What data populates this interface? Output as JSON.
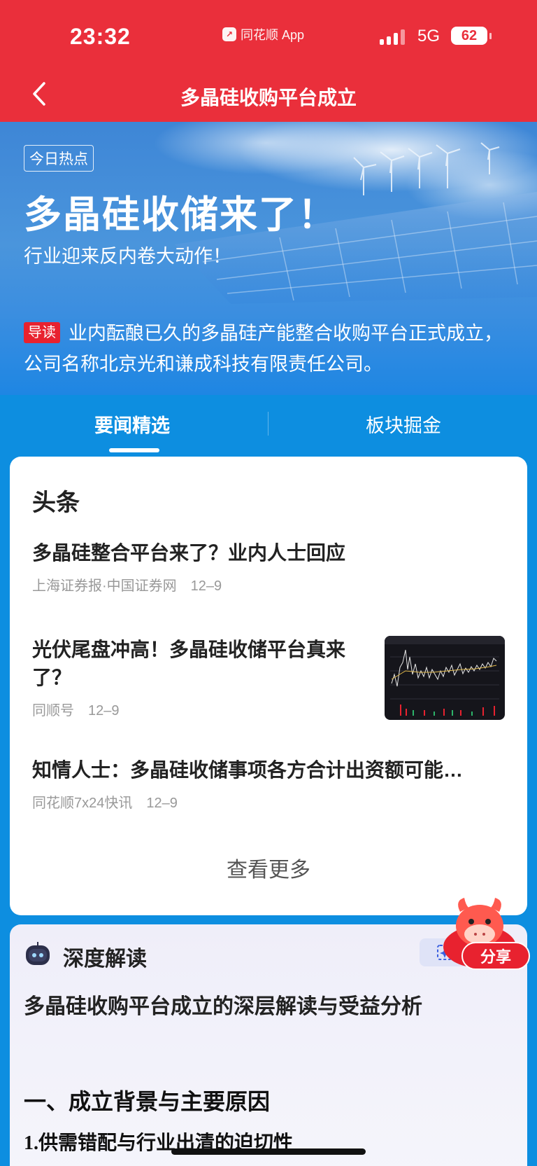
{
  "status_bar": {
    "time": "23:32",
    "app_name": "同花顺 App",
    "network": "5G",
    "battery": "62"
  },
  "nav": {
    "title": "多晶硅收购平台成立"
  },
  "hero": {
    "tag": "今日热点",
    "title": "多晶硅收储来了！",
    "subtitle": "行业迎来反内卷大动作！",
    "guide_tag": "导读",
    "guide_text": "业内酝酿已久的多晶硅产能整合收购平台正式成立，公司名称北京光和谦成科技有限责任公司。"
  },
  "tabs": [
    {
      "label": "要闻精选",
      "active": true
    },
    {
      "label": "板块掘金",
      "active": false
    }
  ],
  "headlines": {
    "title": "头条",
    "items": [
      {
        "title": "多晶硅整合平台来了？业内人士回应",
        "source": "上海证券报·中国证券网",
        "date": "12–9"
      },
      {
        "title": "光伏尾盘冲高！多晶硅收储平台真来了？",
        "source": "同顺号",
        "date": "12–9"
      },
      {
        "title": "知情人士：多晶硅收储事项各方合计出资额可能…",
        "source": "同花顺7x24快讯",
        "date": "12–9"
      }
    ],
    "more_label": "查看更多"
  },
  "deep_read": {
    "title": "深度解读",
    "headline": "多晶硅收购平台成立的深层解读与受益分析",
    "section1": "一、成立背景与主要原因",
    "section2": "1.供需错配与行业出清的迫切性"
  },
  "share": {
    "label": "分享"
  },
  "colors": {
    "brand_red": "#ea2f3b",
    "tab_blue": "#0d8ee0",
    "tag_red": "#e8222f"
  },
  "icons": [
    "back-arrow-icon",
    "signal-icon",
    "battery-icon",
    "robot-icon",
    "ai-sparkle-icon",
    "mascot-icon"
  ]
}
